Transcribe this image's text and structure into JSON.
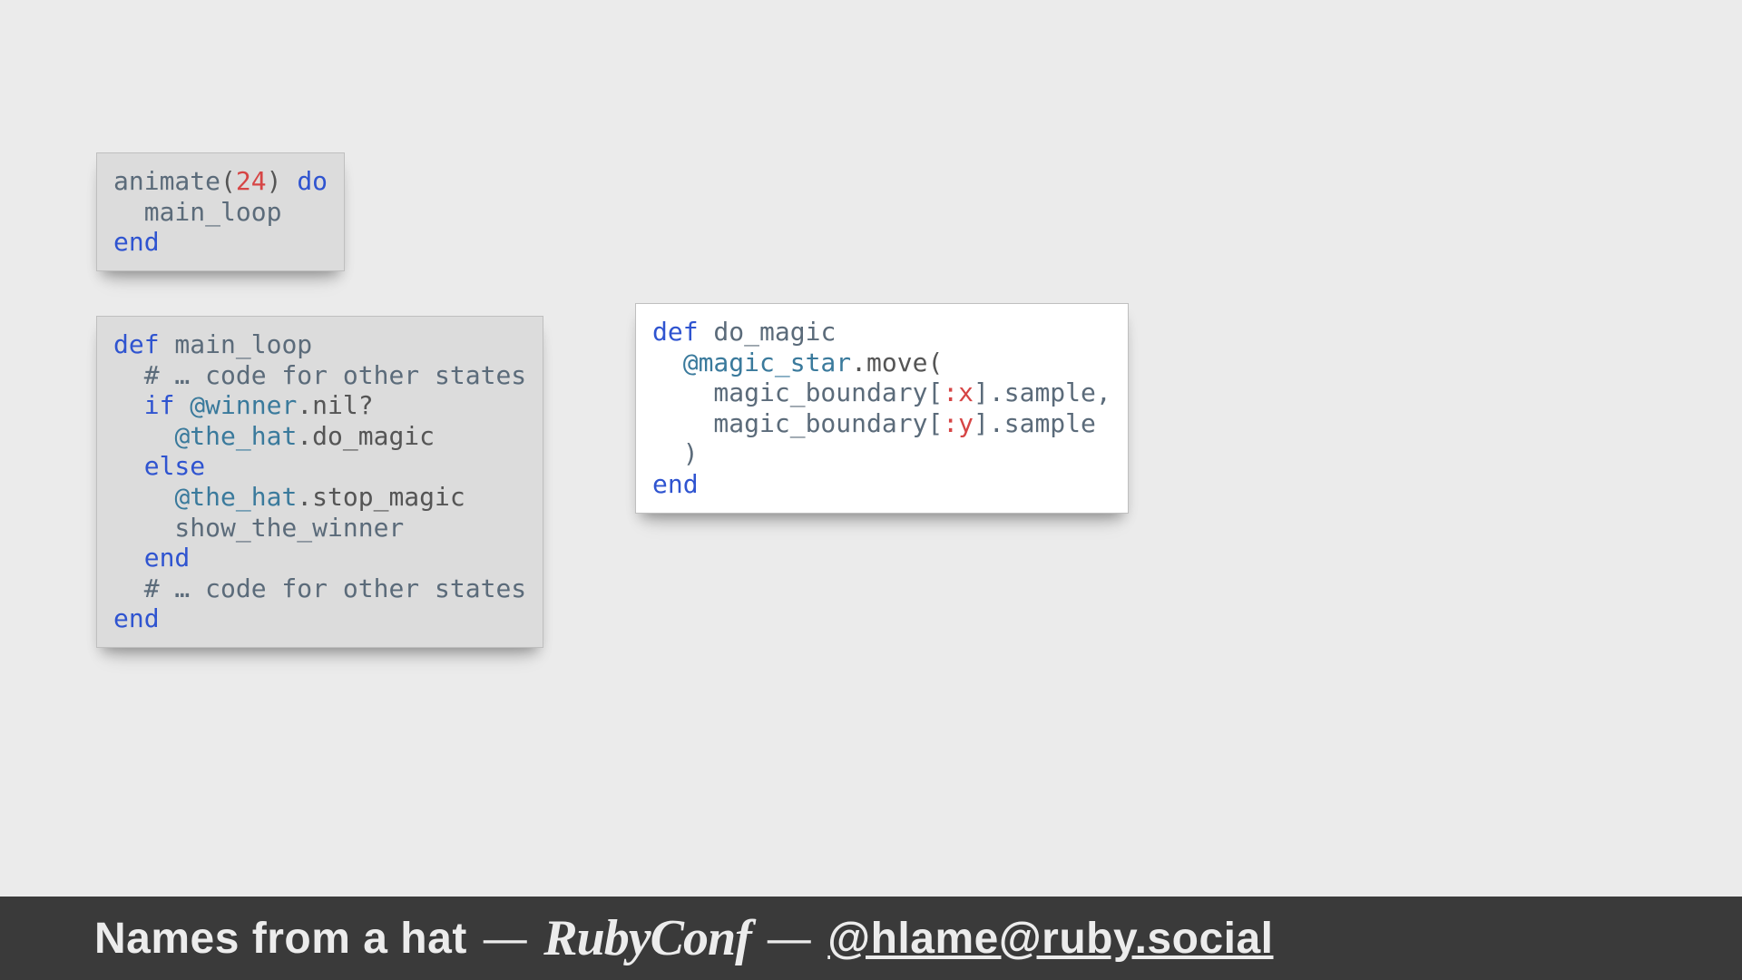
{
  "code_blocks": {
    "animate": {
      "tokens": [
        [
          [
            "id",
            "animate"
          ],
          [
            "paren",
            "("
          ],
          [
            "num",
            "24"
          ],
          [
            "paren",
            ")"
          ],
          [
            "id",
            " "
          ],
          [
            "kw",
            "do"
          ]
        ],
        [
          [
            "id",
            "  main_loop"
          ]
        ],
        [
          [
            "kw",
            "end"
          ]
        ]
      ]
    },
    "main_loop": {
      "tokens": [
        [
          [
            "kw",
            "def"
          ],
          [
            "id",
            " main_loop"
          ]
        ],
        [
          [
            "id",
            "  "
          ],
          [
            "com",
            "# … code for other states"
          ]
        ],
        [
          [
            "id",
            "  "
          ],
          [
            "kw",
            "if"
          ],
          [
            "id",
            " "
          ],
          [
            "ivar",
            "@winner"
          ],
          [
            "call",
            ".nil?"
          ]
        ],
        [
          [
            "id",
            "    "
          ],
          [
            "ivar",
            "@the_hat"
          ],
          [
            "call",
            ".do_magic"
          ]
        ],
        [
          [
            "id",
            "  "
          ],
          [
            "kw",
            "else"
          ]
        ],
        [
          [
            "id",
            "    "
          ],
          [
            "ivar",
            "@the_hat"
          ],
          [
            "call",
            ".stop_magic"
          ]
        ],
        [
          [
            "id",
            "    show_the_winner"
          ]
        ],
        [
          [
            "id",
            "  "
          ],
          [
            "kw",
            "end"
          ]
        ],
        [
          [
            "id",
            "  "
          ],
          [
            "com",
            "# … code for other states"
          ]
        ],
        [
          [
            "kw",
            "end"
          ]
        ]
      ]
    },
    "do_magic": {
      "tokens": [
        [
          [
            "kw",
            "def"
          ],
          [
            "id",
            " do_magic"
          ]
        ],
        [
          [
            "id",
            "  "
          ],
          [
            "ivar",
            "@magic_star"
          ],
          [
            "call",
            ".move("
          ]
        ],
        [
          [
            "id",
            "    magic_boundary["
          ],
          [
            "sym",
            ":x"
          ],
          [
            "id",
            "].sample,"
          ]
        ],
        [
          [
            "id",
            "    magic_boundary["
          ],
          [
            "sym",
            ":y"
          ],
          [
            "id",
            "].sample"
          ]
        ],
        [
          [
            "id",
            "  )"
          ]
        ],
        [
          [
            "kw",
            "end"
          ]
        ]
      ]
    }
  },
  "footer": {
    "title": "Names from a hat",
    "dash": "—",
    "logo": "RubyConf",
    "handle": "@hlame@ruby.social"
  }
}
